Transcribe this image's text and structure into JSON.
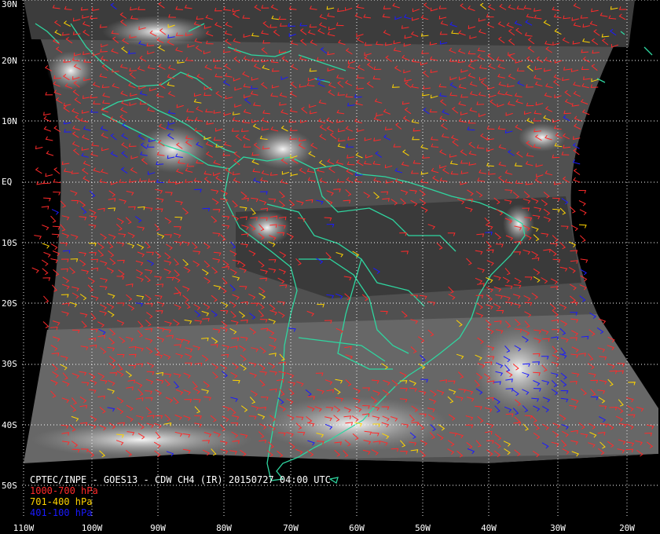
{
  "title": "CPTEC/INPE - GOES13 - CDW CH4 (IR) 20150727 04:00 UTC",
  "legend": [
    {
      "label": "1000-700 hPa",
      "color": "#ff2a2a"
    },
    {
      "label": "701-400 hPa",
      "color": "#ffd400"
    },
    {
      "label": "401-100 hPa",
      "color": "#1a1aff"
    }
  ],
  "lat_labels": [
    "30N",
    "20N",
    "10N",
    "EQ",
    "10S",
    "20S",
    "30S",
    "40S",
    "50S"
  ],
  "lon_labels": [
    "110W",
    "100W",
    "90W",
    "80W",
    "70W",
    "60W",
    "50W",
    "40W",
    "30W",
    "20W"
  ],
  "colors": {
    "coastline": "#2fd6a0",
    "grid": "#ffffff",
    "background": "#000000",
    "satellite_gray": "#4a4a4a"
  }
}
